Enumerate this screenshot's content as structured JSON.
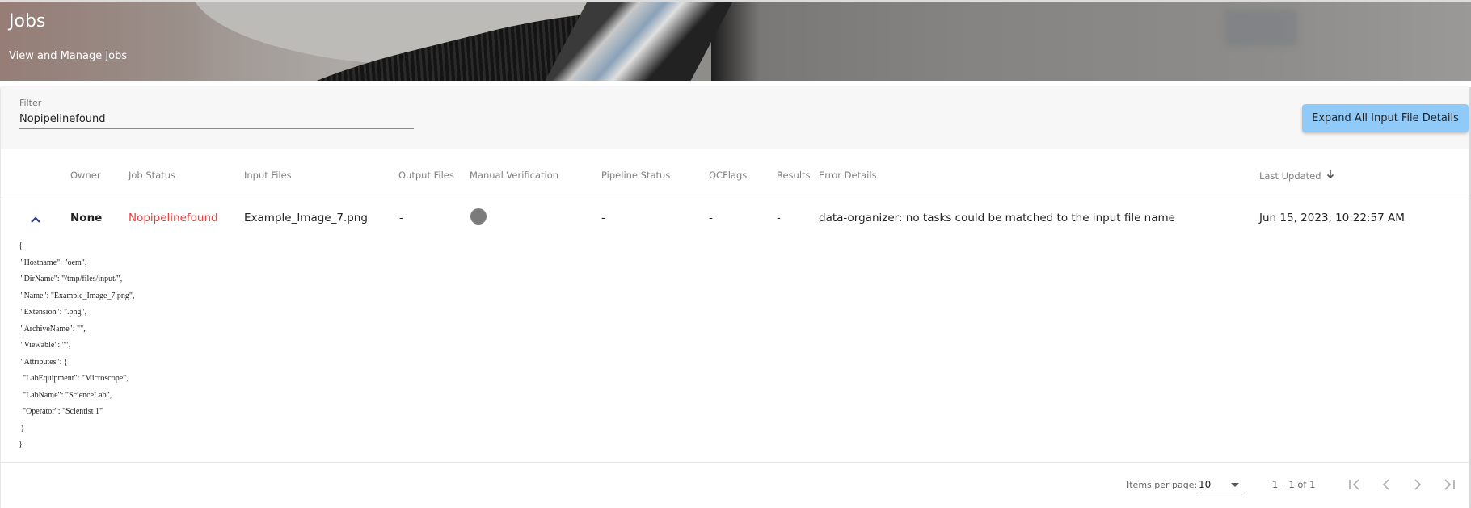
{
  "header": {
    "title": "Jobs",
    "subtitle": "View and Manage Jobs"
  },
  "filter": {
    "label": "Filter",
    "value": "Nopipelinefound"
  },
  "toolbar": {
    "expand_all_label": "Expand All Input File Details"
  },
  "table": {
    "columns": [
      {
        "key": "owner",
        "label": "Owner"
      },
      {
        "key": "job_status",
        "label": "Job Status"
      },
      {
        "key": "input_files",
        "label": "Input Files"
      },
      {
        "key": "output_files",
        "label": "Output Files"
      },
      {
        "key": "manual_verification",
        "label": "Manual Verification"
      },
      {
        "key": "pipeline_status",
        "label": "Pipeline Status"
      },
      {
        "key": "qcflags",
        "label": "QCFlags"
      },
      {
        "key": "results",
        "label": "Results"
      },
      {
        "key": "error_details",
        "label": "Error Details"
      },
      {
        "key": "last_updated",
        "label": "Last Updated",
        "sort": "descending",
        "sort_icon": "arrow-down-icon"
      }
    ],
    "rows": [
      {
        "expanded": true,
        "expand_icon": "chevron-up-icon",
        "owner": "None",
        "job_status": "Nopipelinefound",
        "job_status_color": "#f03a3a",
        "input_files": "Example_Image_7.png",
        "output_files": "-",
        "manual_verification_indicator": "grey-circle",
        "manual_verification_color": "#7b7b7b",
        "pipeline_status": "-",
        "qcflags": "-",
        "results": "-",
        "error_details": "data-organizer: no tasks could be matched to the input file name",
        "last_updated": "Jun 15, 2023, 10:22:57 AM",
        "details_lines": [
          "{",
          " \"Hostname\": \"oem\",",
          " \"DirName\": \"/tmp/files/input/\",",
          " \"Name\": \"Example_Image_7.png\",",
          " \"Extension\": \".png\",",
          " \"ArchiveName\": \"\",",
          " \"Viewable\": \"\",",
          " \"Attributes\": {",
          "  \"LabEquipment\": \"Microscope\",",
          "  \"LabName\": \"ScienceLab\",",
          "  \"Operator\": \"Scientist 1\"",
          " }",
          "}"
        ]
      }
    ]
  },
  "paginator": {
    "items_per_page_label": "Items per page:",
    "items_per_page_value": "10",
    "range_label": "1 – 1 of 1",
    "buttons": [
      "first-page",
      "previous-page",
      "next-page",
      "last-page"
    ]
  },
  "colors": {
    "accent_button": "#90caf9",
    "error_text": "#f03a3a",
    "chevron": "#2b3a8f"
  }
}
